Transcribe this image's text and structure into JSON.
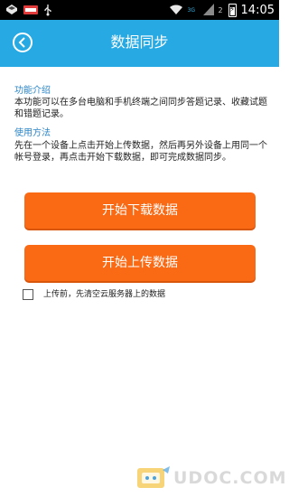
{
  "status_bar": {
    "network_label": "3G",
    "sim_label": "2",
    "time": "14:05"
  },
  "header": {
    "title": "数据同步"
  },
  "intro": {
    "heading": "功能介绍",
    "text": "本功能可以在多台电脑和手机终端之间同步答题记录、收藏试题和错题记录。"
  },
  "usage": {
    "heading": "使用方法",
    "text": "先在一个设备上点击开始上传数据，然后再另外设备上用同一个帐号登录，再点击开始下载数据，即可完成数据同步。"
  },
  "actions": {
    "download_label": "开始下载数据",
    "upload_label": "开始上传数据"
  },
  "option": {
    "clear_label": "上传前，先清空云服务器上的数据",
    "checked": false
  },
  "watermark": {
    "text": "UDOC.COM"
  },
  "colors": {
    "header_bg": "#27aae4",
    "button_bg": "#fa6a14",
    "section_heading": "#2b86c8"
  }
}
